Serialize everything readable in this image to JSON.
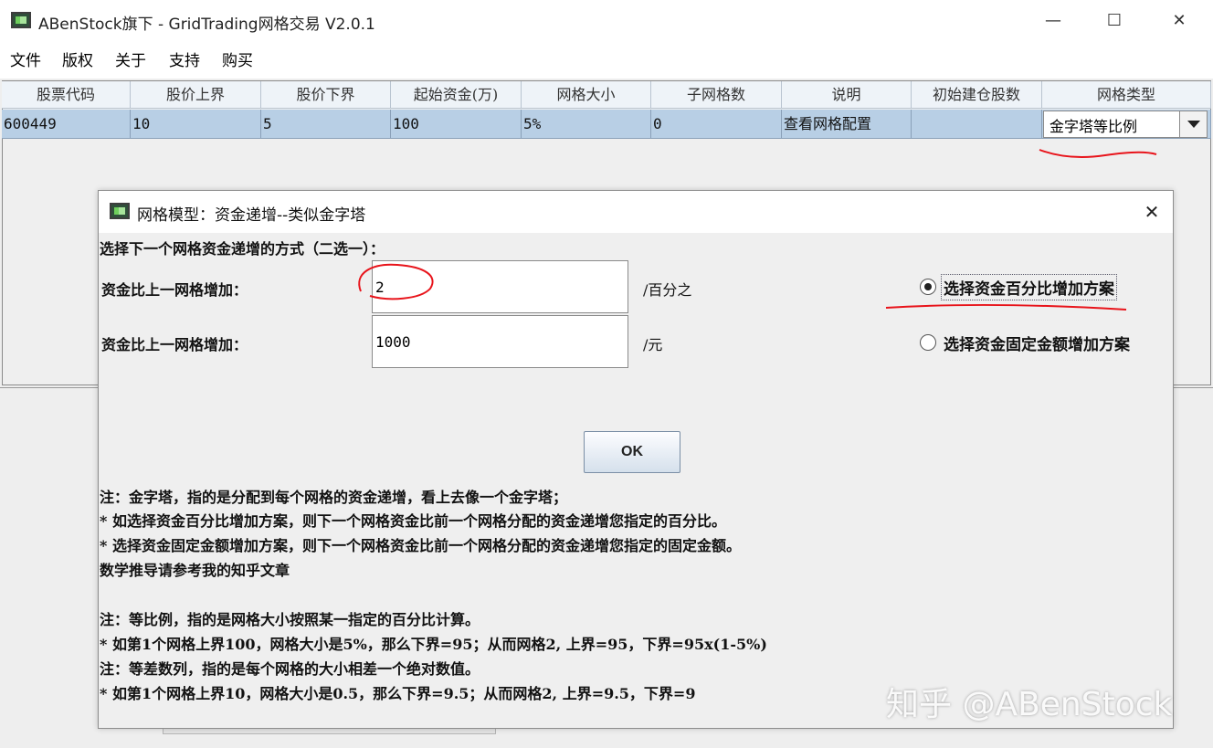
{
  "window": {
    "title": "ABenStock旗下 - GridTrading网格交易 V2.0.1",
    "minimize": "—",
    "maximize": "☐",
    "close": "✕"
  },
  "menu": {
    "items": [
      "文件",
      "版权",
      "关于",
      "支持",
      "购买"
    ]
  },
  "table": {
    "headers": [
      "股票代码",
      "股价上界",
      "股价下界",
      "起始资金(万)",
      "网格大小",
      "子网格数",
      "说明",
      "初始建仓股数",
      "网格类型"
    ],
    "row": [
      "600449",
      "10",
      "5",
      "100",
      "5%",
      "0",
      "查看网格配置",
      "",
      "金字塔等比例"
    ]
  },
  "dialog": {
    "title": "网格模型：资金递增--类似金字塔",
    "close": "✕",
    "prompt": "选择下一个网格资金递增的方式（二选一）：",
    "row1_label": "资金比上一网格增加：",
    "row1_value": "2",
    "row1_unit": "/百分之",
    "row2_label": "资金比上一网格增加：",
    "row2_value": "1000",
    "row2_unit": "/元",
    "radio1_label": "选择资金百分比增加方案",
    "radio2_label": "选择资金固定金额增加方案",
    "radio1_checked": true,
    "ok_label": "OK",
    "notes": [
      "注：金字塔，指的是分配到每个网格的资金递增，看上去像一个金字塔；",
      "* 如选择资金百分比增加方案，则下一个网格资金比前一个网格分配的资金递增您指定的百分比。",
      "* 选择资金固定金额增加方案，则下一个网格资金比前一个网格分配的资金递增您指定的固定金额。",
      "数学推导请参考我的知乎文章",
      "注：等比例，指的是网格大小按照某一指定的百分比计算。",
      "* 如第1个网格上界100，网格大小是5%，那么下界=95；从而网格2, 上界=95，下界=95x(1-5%)",
      "注：等差数列，指的是每个网格的大小相差一个绝对数值。",
      "* 如第1个网格上界10，网格大小是0.5，那么下界=9.5；从而网格2, 上界=9.5，下界=9"
    ]
  },
  "watermark": "知乎 @ABenStock",
  "colors": {
    "selection": "#b8cfe5",
    "annotation": "#e8141b"
  }
}
